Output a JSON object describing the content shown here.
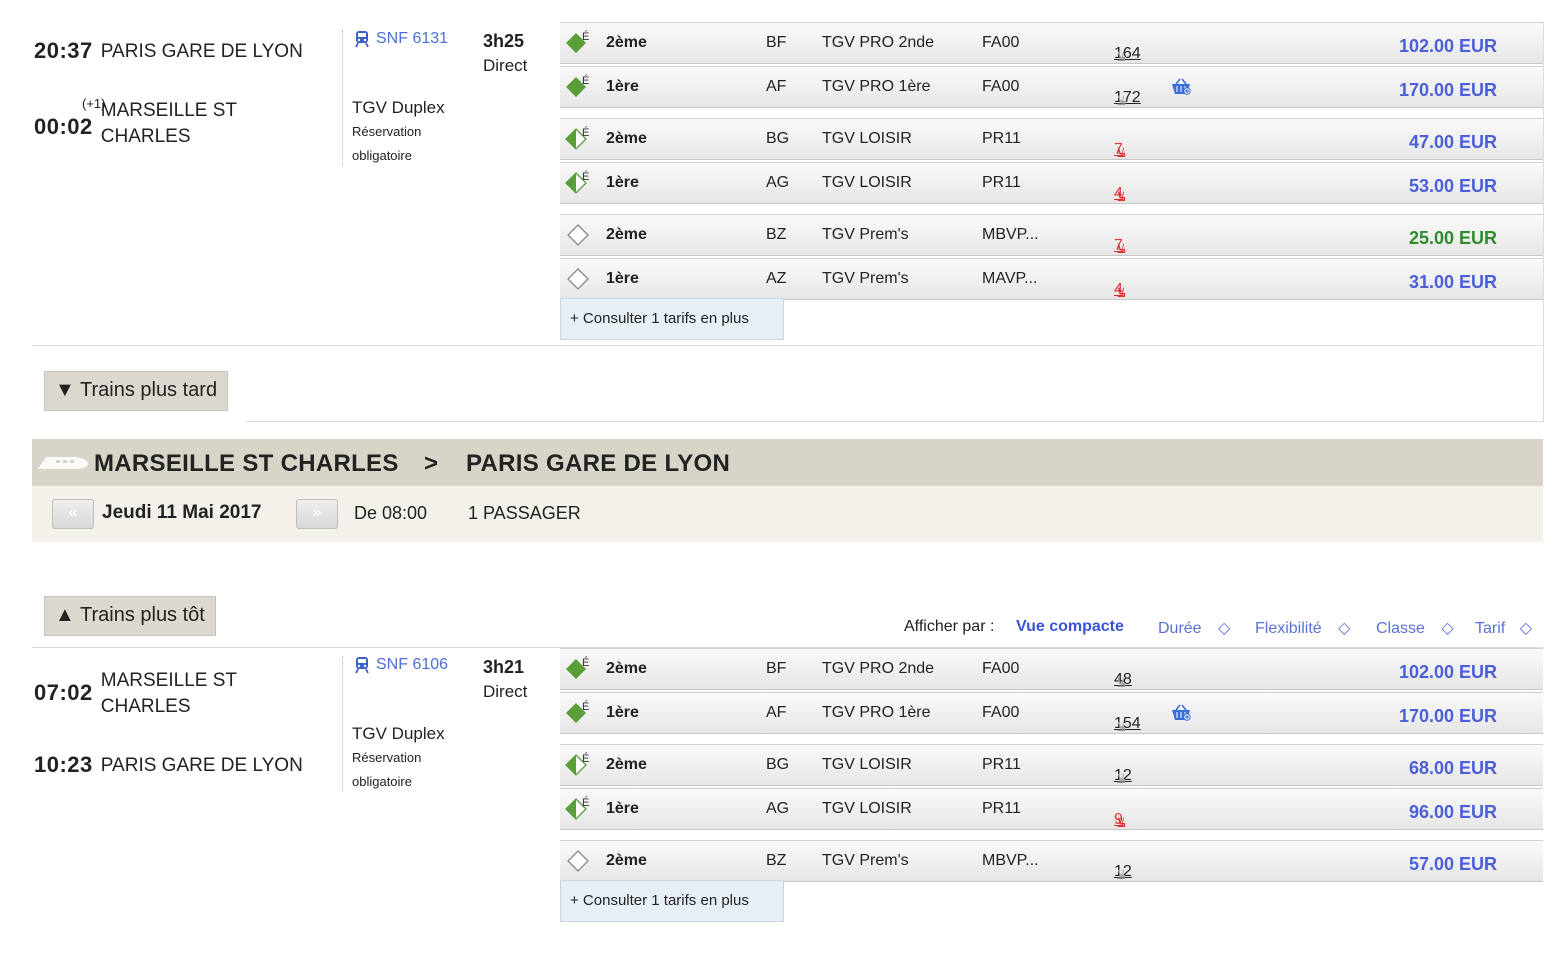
{
  "train1": {
    "dep_time": "20:37",
    "dep_station": "PARIS GARE DE LYON",
    "arr_time": "00:02",
    "arr_day_offset": "(+1)",
    "arr_station_l1": "MARSEILLE ST",
    "arr_station_l2": "CHARLES",
    "train_number": "SNF 6131",
    "duration": "3h25",
    "direct": "Direct",
    "train_type": "TGV Duplex",
    "reservation_l1": "Réservation",
    "reservation_l2": "obligatoire",
    "fares": [
      {
        "class": "2ème",
        "code": "BF",
        "product": "TGV PRO 2nde",
        "fare_code": "FA00",
        "seats": "164",
        "price": "102.00 EUR",
        "icon": "green-e"
      },
      {
        "class": "1ère",
        "code": "AF",
        "product": "TGV PRO 1ère",
        "fare_code": "FA00",
        "seats": "172",
        "price": "170.00 EUR",
        "icon": "green-e",
        "extra": "basket-icon"
      },
      {
        "class": "2ème",
        "code": "BG",
        "product": "TGV LOISIR",
        "fare_code": "PR11",
        "seats": "7",
        "price": "47.00 EUR",
        "icon": "half-green-e",
        "seats_red": true
      },
      {
        "class": "1ère",
        "code": "AG",
        "product": "TGV LOISIR",
        "fare_code": "PR11",
        "seats": "4",
        "price": "53.00 EUR",
        "icon": "half-green-e",
        "seats_red": true
      },
      {
        "class": "2ème",
        "code": "BZ",
        "product": "TGV Prem's",
        "fare_code": "MBVP...",
        "seats": "7",
        "price": "25.00 EUR",
        "icon": "empty-diamond",
        "seats_red": true,
        "price_green": true
      },
      {
        "class": "1ère",
        "code": "AZ",
        "product": "TGV Prem's",
        "fare_code": "MAVP...",
        "seats": "4",
        "price": "31.00 EUR",
        "icon": "empty-diamond",
        "seats_red": true
      }
    ],
    "more_fares": "+ Consulter 1 tarifs en plus"
  },
  "later_button": "▼ Trains plus tard",
  "return_header": {
    "from": "MARSEILLE ST CHARLES",
    "sep": ">",
    "to": "PARIS GARE DE LYON",
    "date": "Jeudi 11 Mai 2017",
    "from_time": "De 08:00",
    "passengers": "1 PASSAGER",
    "prev_arrow": "«",
    "next_arrow": "»"
  },
  "earlier_button": "▲ Trains plus tôt",
  "sort": {
    "label": "Afficher par :",
    "compact": "Vue compacte",
    "duration": "Durée",
    "flexibility": "Flexibilité",
    "class": "Classe",
    "fare": "Tarif"
  },
  "train2": {
    "dep_time": "07:02",
    "dep_station_l1": "MARSEILLE ST",
    "dep_station_l2": "CHARLES",
    "arr_time": "10:23",
    "arr_station": "PARIS GARE DE LYON",
    "train_number": "SNF 6106",
    "duration": "3h21",
    "direct": "Direct",
    "train_type": "TGV Duplex",
    "reservation_l1": "Réservation",
    "reservation_l2": "obligatoire",
    "fares": [
      {
        "class": "2ème",
        "code": "BF",
        "product": "TGV PRO 2nde",
        "fare_code": "FA00",
        "seats": "48",
        "price": "102.00 EUR",
        "icon": "green-e"
      },
      {
        "class": "1ère",
        "code": "AF",
        "product": "TGV PRO 1ère",
        "fare_code": "FA00",
        "seats": "154",
        "price": "170.00 EUR",
        "icon": "green-e",
        "extra": "basket-icon"
      },
      {
        "class": "2ème",
        "code": "BG",
        "product": "TGV LOISIR",
        "fare_code": "PR11",
        "seats": "12",
        "price": "68.00 EUR",
        "icon": "half-green-e"
      },
      {
        "class": "1ère",
        "code": "AG",
        "product": "TGV LOISIR",
        "fare_code": "PR11",
        "seats": "9",
        "price": "96.00 EUR",
        "icon": "half-green-e",
        "seats_red": true
      },
      {
        "class": "2ème",
        "code": "BZ",
        "product": "TGV Prem's",
        "fare_code": "MBVP...",
        "seats": "12",
        "price": "57.00 EUR",
        "icon": "empty-diamond"
      }
    ],
    "more_fares": "+ Consulter 1 tarifs en plus"
  },
  "colors": {
    "price_blue": "#4a5fd8",
    "price_green": "#2e8b2e",
    "seats_red": "#d33333",
    "header_bg": "#d9d4c8",
    "diamond_green": "#5a9e3a"
  }
}
